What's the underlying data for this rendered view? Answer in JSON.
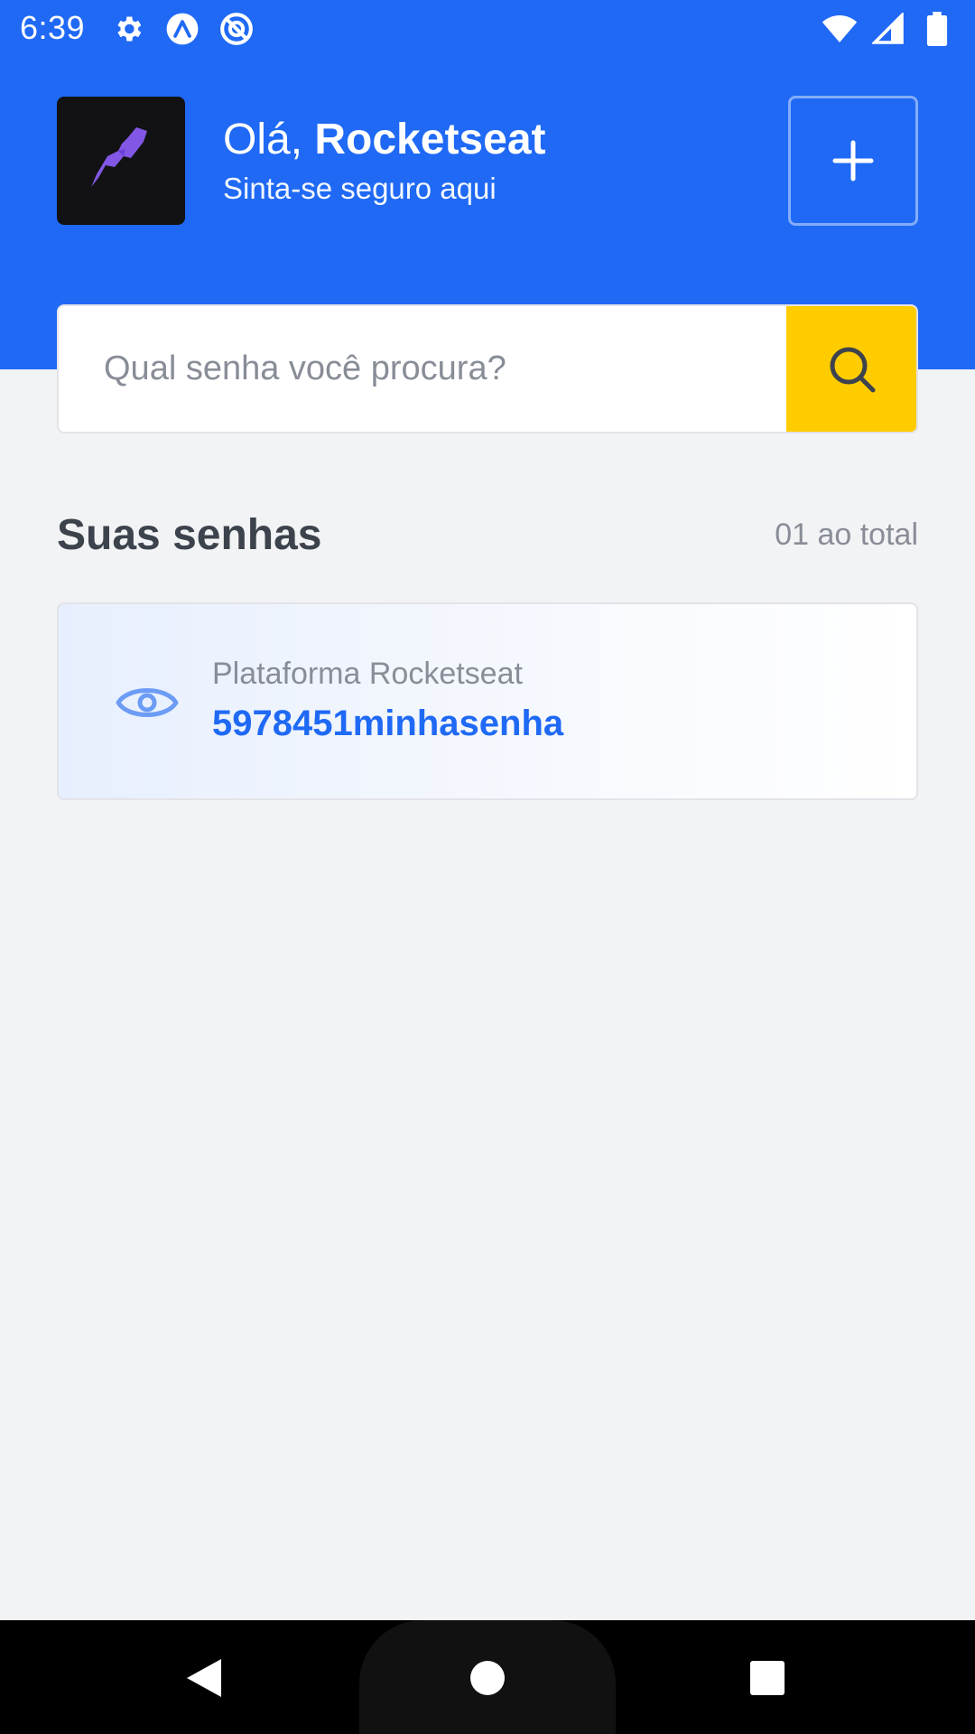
{
  "status_bar": {
    "time": "6:39",
    "left_icons": [
      "gear-icon",
      "expo-icon",
      "no-entry-icon"
    ],
    "right_icons": [
      "wifi-icon",
      "signal-icon",
      "battery-icon"
    ]
  },
  "header": {
    "greeting_prefix": "Olá,",
    "user_name": "Rocketseat",
    "subtitle": "Sinta-se seguro aqui",
    "avatar_icon": "rocket-icon",
    "add_icon": "plus-icon"
  },
  "search": {
    "placeholder": "Qual senha você procura?",
    "value": "",
    "button_icon": "search-icon"
  },
  "passwords_section": {
    "title": "Suas senhas",
    "count_label": "01 ao total",
    "items": [
      {
        "service": "Plataforma Rocketseat",
        "password": "5978451minhasenha",
        "icon": "eye-icon"
      }
    ]
  },
  "nav_bar": {
    "back_icon": "back-icon",
    "home_icon": "home-icon",
    "recents_icon": "recents-icon"
  },
  "colors": {
    "primary": "#1F69F5",
    "accent": "#FFCC00",
    "background": "#F2F3F5",
    "heading": "#3D434D",
    "muted": "#888D97"
  }
}
